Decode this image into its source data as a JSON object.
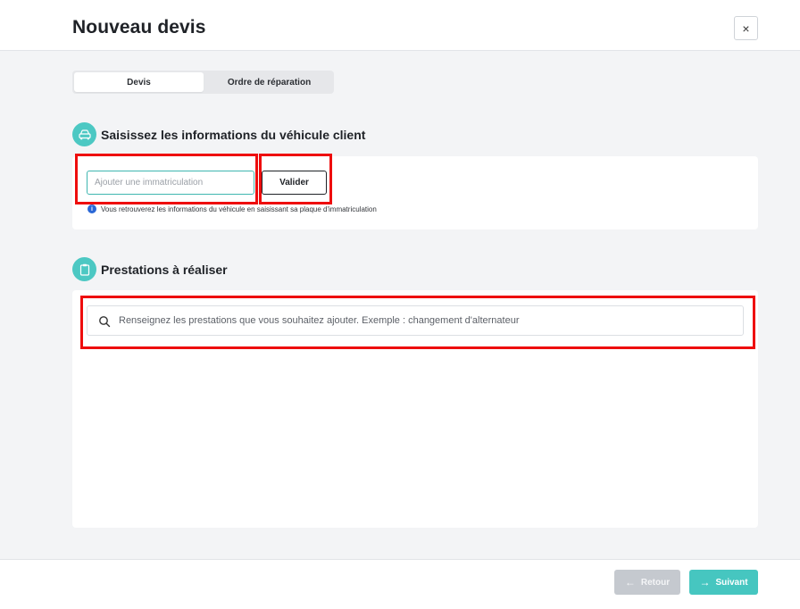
{
  "header": {
    "title": "Nouveau devis",
    "close_label": "×"
  },
  "tabs": [
    {
      "label": "Devis",
      "active": true
    },
    {
      "label": "Ordre de réparation",
      "active": false
    }
  ],
  "vehicle_section": {
    "icon": "car-icon",
    "title": "Saisissez les informations du véhicule client",
    "plate_placeholder": "Ajouter une immatriculation",
    "validate_label": "Valider",
    "hint_icon": "info-icon",
    "hint_text": "Vous retrouverez les informations du véhicule en saisissant sa plaque d'immatriculation"
  },
  "services_section": {
    "icon": "clipboard-icon",
    "title": "Prestations à réaliser",
    "search_icon": "search-icon",
    "search_placeholder": "Renseignez les prestations que vous souhaitez ajouter. Exemple : changement d'alternateur"
  },
  "footer": {
    "back_label": "Retour",
    "next_label": "Suivant"
  },
  "colors": {
    "accent": "#46c6c0",
    "highlight": "#ee0d0d",
    "background": "#f3f4f6",
    "disabled": "#c5c9cf"
  }
}
